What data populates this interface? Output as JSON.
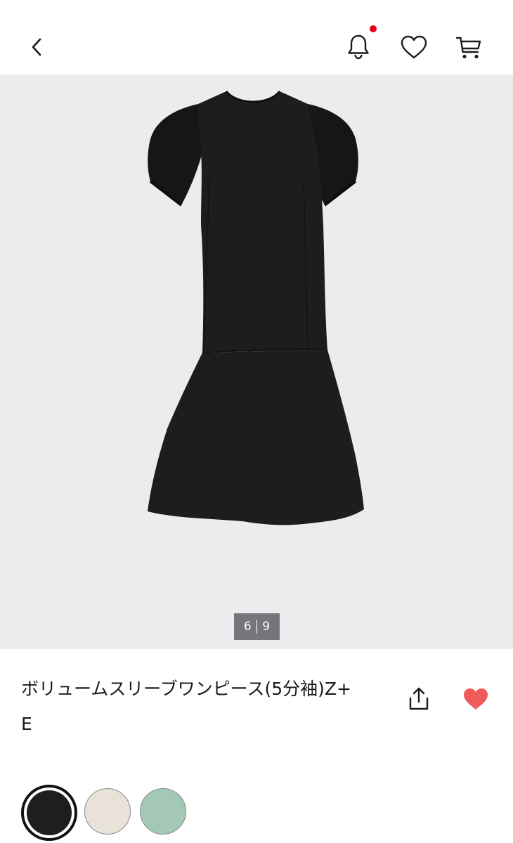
{
  "header": {
    "back_icon": "chevron-left-icon",
    "notifications_icon": "bell-icon",
    "has_notification": true,
    "notification_color": "#e3001b",
    "favorites_icon": "heart-outline-icon",
    "cart_icon": "cart-icon"
  },
  "gallery": {
    "background": "#ececee",
    "current": "6",
    "total": "9"
  },
  "product": {
    "title": "ボリュームスリーブワンピース(5分袖)Z+E",
    "share_icon": "share-icon",
    "like_icon": "heart-filled-icon",
    "liked": true,
    "like_color": "#f05a5a"
  },
  "colors": [
    {
      "hex": "#1e1e20",
      "selected": true
    },
    {
      "hex": "#e8e2d8",
      "selected": false
    },
    {
      "hex": "#a4c8b6",
      "selected": false
    }
  ]
}
